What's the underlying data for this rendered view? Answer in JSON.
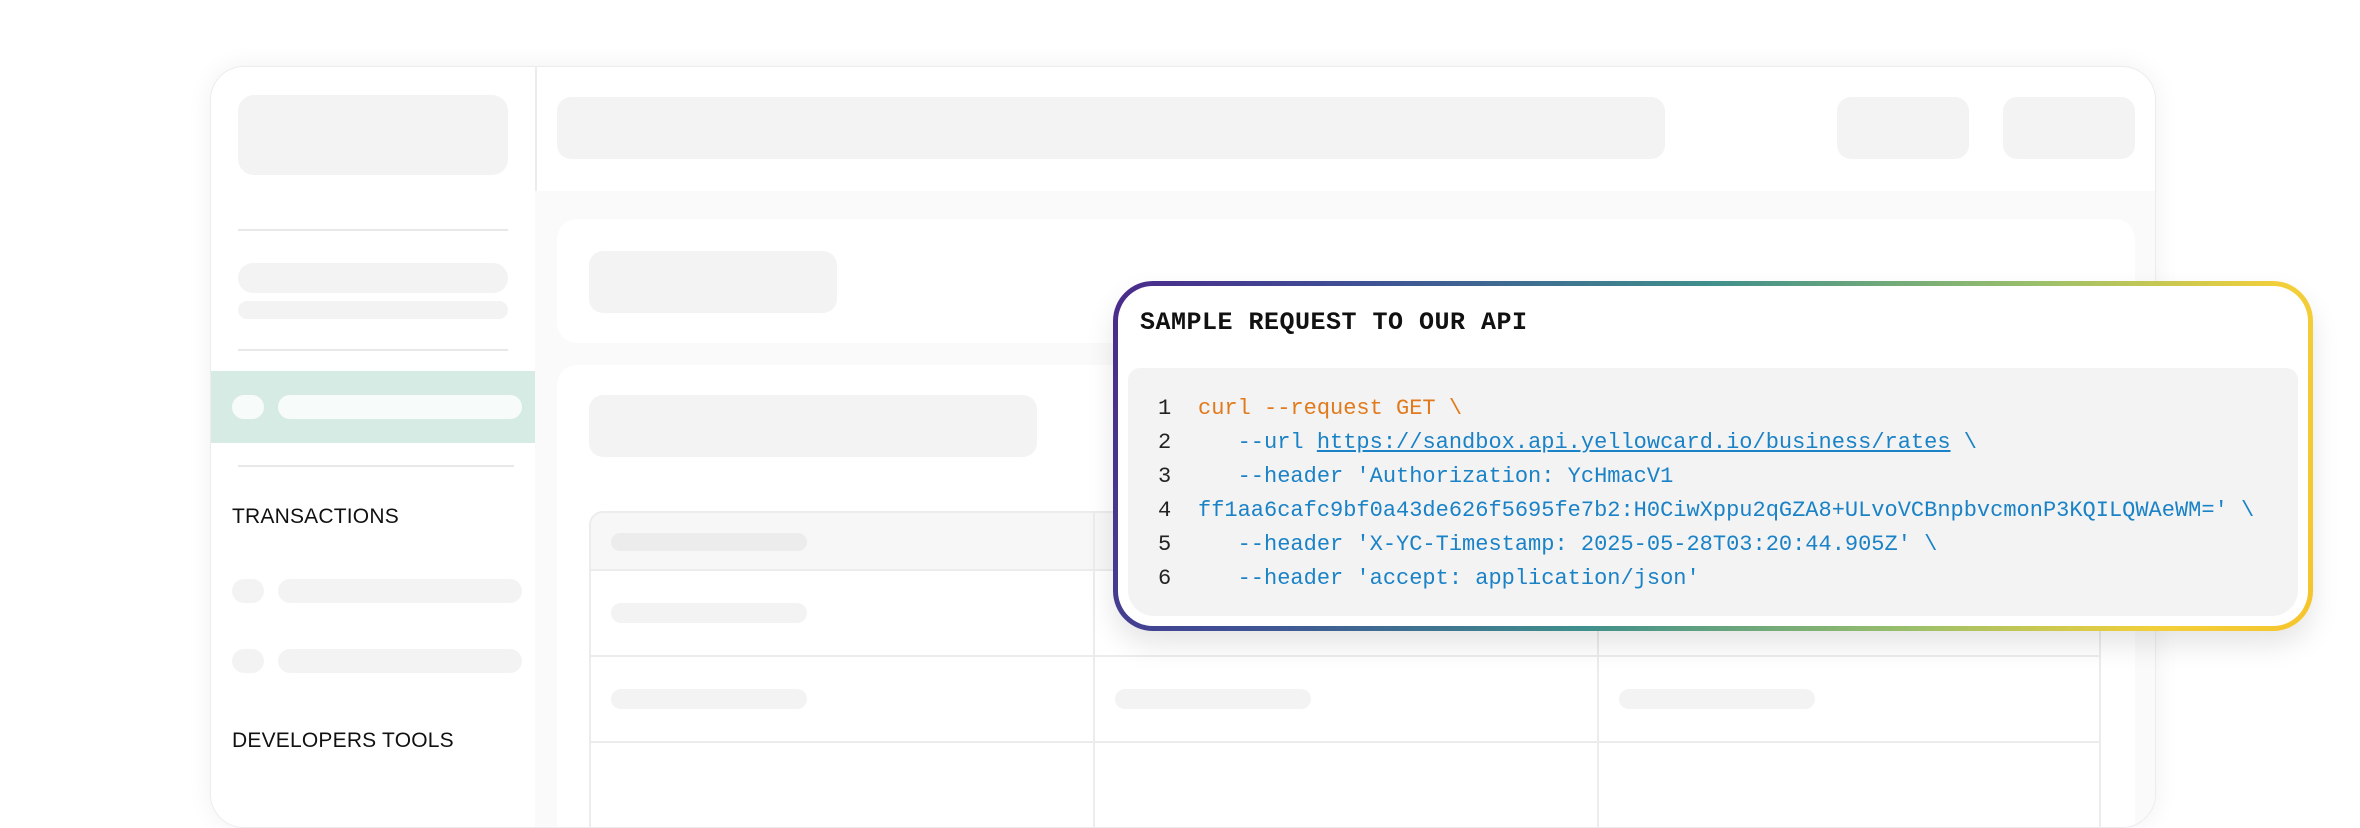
{
  "sidebar": {
    "sections": [
      "TRANSACTIONS",
      "DEVELOPERS TOOLS"
    ]
  },
  "api_popup": {
    "title": "SAMPLE REQUEST TO OUR API",
    "lines": [
      {
        "num": "1",
        "parts": [
          {
            "text": "curl --request GET \\",
            "style": "orange"
          }
        ]
      },
      {
        "num": "2",
        "parts": [
          {
            "text": "   --url ",
            "style": "blue"
          },
          {
            "text": "https://sandbox.api.yellowcard.io/business/rates",
            "style": "link"
          },
          {
            "text": " \\",
            "style": "blue"
          }
        ]
      },
      {
        "num": "3",
        "parts": [
          {
            "text": "   --header 'Authorization: YcHmacV1",
            "style": "blue"
          }
        ]
      },
      {
        "num": "4",
        "parts": [
          {
            "text": "ff1aa6cafc9bf0a43de626f5695fe7b2:H0CiwXppu2qGZA8+ULvoVCBnpbvcmonP3KQILQWAeWM=' \\",
            "style": "blue"
          }
        ]
      },
      {
        "num": "5",
        "parts": [
          {
            "text": "   --header 'X-YC-Timestamp: 2025-05-28T03:20:44.905Z' \\",
            "style": "blue"
          }
        ]
      },
      {
        "num": "6",
        "parts": [
          {
            "text": "   --header 'accept: application/json'",
            "style": "blue"
          }
        ]
      }
    ]
  },
  "colors": {
    "active_item": "#d7ebe5",
    "code_orange": "#e07a1c",
    "code_blue": "#1a82c6",
    "gradient": [
      "#4a2a8a",
      "#3f8f8c",
      "#9cc06a",
      "#f6c42c"
    ]
  }
}
